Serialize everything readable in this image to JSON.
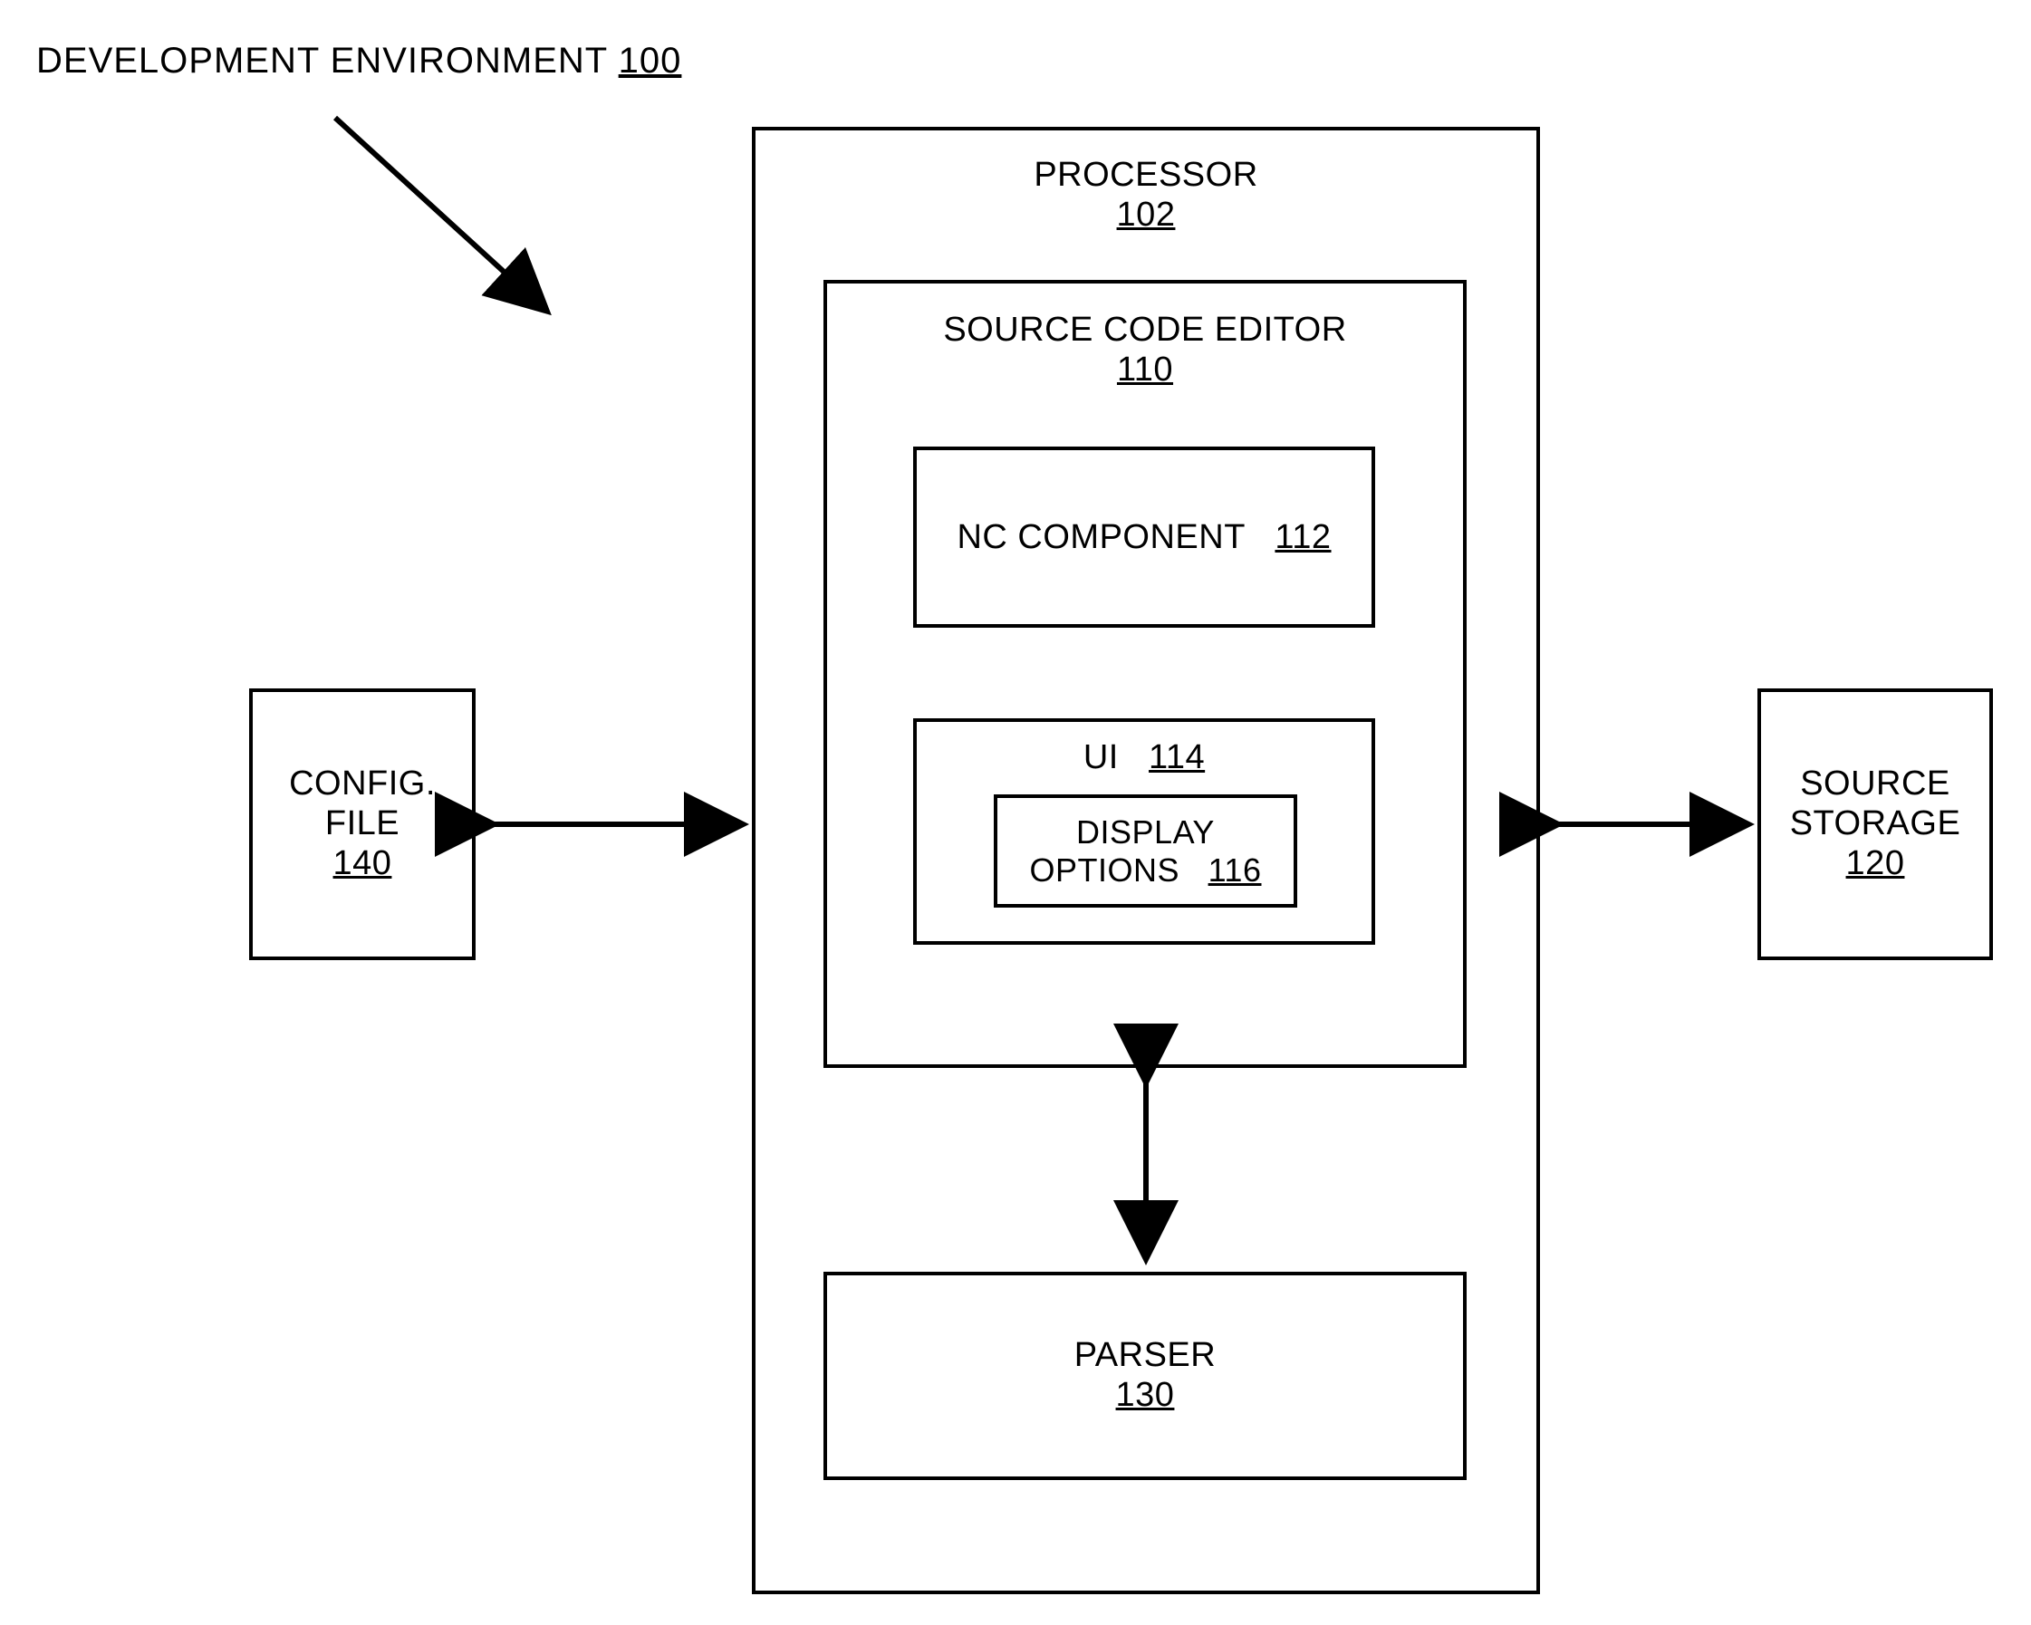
{
  "title": {
    "label": "DEVELOPMENT ENVIRONMENT",
    "ref": "100"
  },
  "config": {
    "line1": "CONFIG.",
    "line2": "FILE",
    "ref": "140"
  },
  "storage": {
    "line1": "SOURCE",
    "line2": "STORAGE",
    "ref": "120"
  },
  "processor": {
    "label": "PROCESSOR",
    "ref": "102"
  },
  "editor": {
    "label": "SOURCE CODE EDITOR",
    "ref": "110"
  },
  "nc": {
    "label": "NC COMPONENT",
    "ref": "112"
  },
  "ui": {
    "label": "UI",
    "ref": "114"
  },
  "display": {
    "line1": "DISPLAY",
    "line2": "OPTIONS",
    "ref": "116"
  },
  "parser": {
    "label": "PARSER",
    "ref": "130"
  }
}
